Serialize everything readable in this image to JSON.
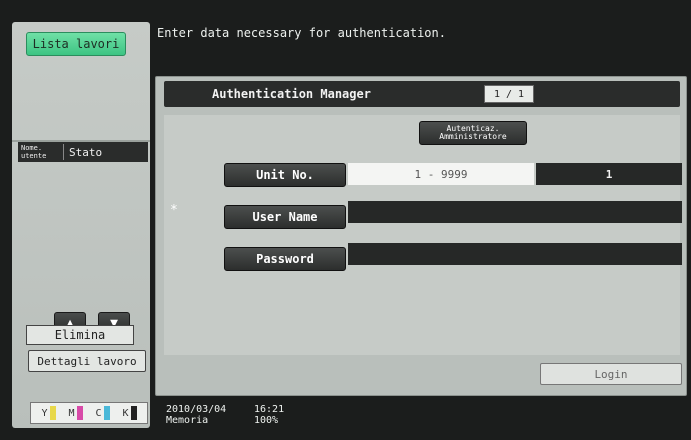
{
  "left": {
    "jobs_list_label": "Lista lavori",
    "col_user": "Nome. utente",
    "col_status": "Stato",
    "arrow_up": "▲",
    "arrow_down": "▼",
    "delete_label": "Elimina",
    "details_label": "Dettagli lavoro",
    "toner": [
      {
        "letter": "Y",
        "color": "#e8d84a"
      },
      {
        "letter": "M",
        "color": "#d84aa8"
      },
      {
        "letter": "C",
        "color": "#4ab8d8"
      },
      {
        "letter": "K",
        "color": "#222222"
      }
    ]
  },
  "header": {
    "message": "Enter data necessary for authentication."
  },
  "panel": {
    "title": "Authentication Manager",
    "page_indicator": "1 / 1",
    "admin_line1": "Autenticaz.",
    "admin_line2": "Amministratore",
    "unit_label": "Unit No.",
    "unit_range": "1 - 9999",
    "unit_value": "1",
    "required_mark": "*",
    "user_label": "User Name",
    "user_value": "",
    "password_label": "Password",
    "password_value": "",
    "login_label": "Login"
  },
  "status": {
    "date": "2010/03/04",
    "memory_label": "Memoria",
    "time": "16:21",
    "memory_value": "100%"
  }
}
